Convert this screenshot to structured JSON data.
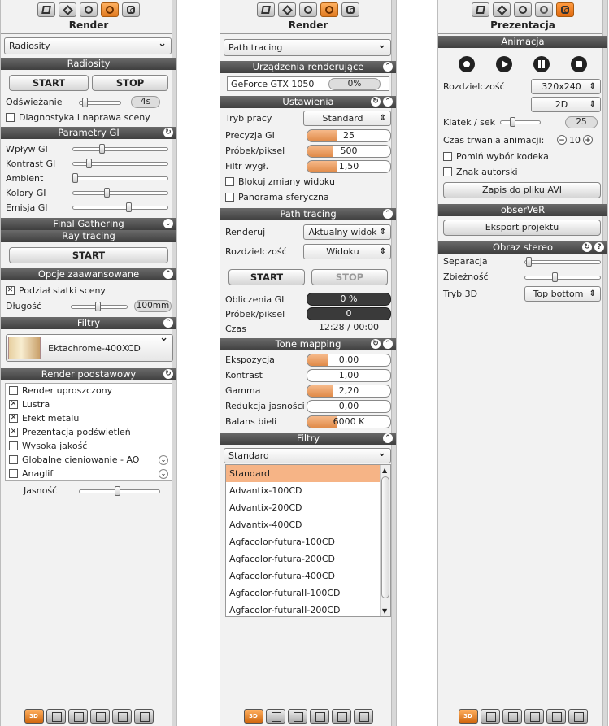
{
  "p1": {
    "title": "Render",
    "mode": "Radiosity",
    "radiosity_header": "Radiosity",
    "start": "START",
    "stop": "STOP",
    "refresh_label": "Odświeżanie",
    "refresh_value": "4s",
    "diag_label": "Diagnostyka i naprawa sceny",
    "gi_header": "Parametry GI",
    "gi_params": [
      {
        "label": "Wpływ GI",
        "level": 0.3
      },
      {
        "label": "Kontrast GI",
        "level": 0.15
      },
      {
        "label": "Ambient",
        "level": 0.0
      },
      {
        "label": "Kolory GI",
        "level": 0.35
      },
      {
        "label": "Emisja GI",
        "level": 0.6
      }
    ],
    "final_gathering": "Final Gathering",
    "ray_tracing": "Ray tracing",
    "rt_start": "START",
    "adv_header": "Opcje zaawansowane",
    "mesh_label": "Podział siatki sceny",
    "length_label": "Długość",
    "length_value": "100mm",
    "filters_header": "Filtry",
    "filter_name": "Ektachrome-400XCD",
    "basic_header": "Render podstawowy",
    "basic_items": [
      {
        "label": "Render uproszczony",
        "checked": false
      },
      {
        "label": "Lustra",
        "checked": true
      },
      {
        "label": "Efekt metalu",
        "checked": true
      },
      {
        "label": "Prezentacja podświetleń",
        "checked": true
      },
      {
        "label": "Wysoka jakość",
        "checked": false
      },
      {
        "label": "Globalne cieniowanie - AO",
        "checked": false
      },
      {
        "label": "Anaglif",
        "checked": false
      }
    ],
    "brightness_label": "Jasność"
  },
  "p2": {
    "title": "Render",
    "mode": "Path tracing",
    "devices_header": "Urządzenia renderujące",
    "device_name": "GeForce GTX 1050",
    "device_value": "0%",
    "settings_header": "Ustawienia",
    "work_mode_label": "Tryb pracy",
    "work_mode_value": "Standard",
    "settings": [
      {
        "label": "Precyzja GI",
        "value": "25",
        "level": 0.35
      },
      {
        "label": "Próbek/piksel",
        "value": "500",
        "level": 0.3
      },
      {
        "label": "Filtr wygł.",
        "value": "1,50",
        "level": 0.35
      }
    ],
    "lock_label": "Blokuj zmiany widoku",
    "panorama_label": "Panorama sferyczna",
    "pt_header": "Path tracing",
    "render_label": "Renderuj",
    "render_value": "Aktualny widok",
    "res_label": "Rozdzielczość",
    "res_value": "Widoku",
    "start": "START",
    "stop": "STOP",
    "stats": [
      {
        "label": "Obliczenia GI",
        "value": "0 %",
        "dark": true
      },
      {
        "label": "Próbek/piksel",
        "value": "0",
        "dark": true
      },
      {
        "label": "Czas",
        "value": "12:28 / 00:00",
        "dark": false
      }
    ],
    "tone_header": "Tone mapping",
    "tone": [
      {
        "label": "Ekspozycja",
        "value": "0,00",
        "level": 0.25
      },
      {
        "label": "Kontrast",
        "value": "1,00",
        "level": 0.0
      },
      {
        "label": "Gamma",
        "value": "2,20",
        "level": 0.3
      },
      {
        "label": "Redukcja jasności",
        "value": "0,00",
        "level": 0.0
      },
      {
        "label": "Balans bieli",
        "value": "6000 K",
        "level": 0.35
      }
    ],
    "filters_header": "Filtry",
    "filter_value": "Standard",
    "filter_list": [
      "Standard",
      "Advantix-100CD",
      "Advantix-200CD",
      "Advantix-400CD",
      "Agfacolor-futura-100CD",
      "Agfacolor-futura-200CD",
      "Agfacolor-futura-400CD",
      "Agfacolor-futuraII-100CD",
      "Agfacolor-futuraII-200CD"
    ]
  },
  "p3": {
    "title": "Prezentacja",
    "anim_header": "Animacja",
    "res_label": "Rozdzielczość",
    "res_value": "320x240",
    "mode_value": "2D",
    "fps_label": "Klatek / sek",
    "fps_value": "25",
    "duration_label": "Czas trwania animacji:",
    "duration_value": "10",
    "skip_codec_label": "Pomiń wybór kodeka",
    "watermark_label": "Znak autorski",
    "save_avi": "Zapis do pliku AVI",
    "observer_header": "obserVeR",
    "export_project": "Eksport projektu",
    "stereo_header": "Obraz stereo",
    "separation_label": "Separacja",
    "convergence_label": "Zbieżność",
    "mode3d_label": "Tryb 3D",
    "mode3d_value": "Top bottom"
  },
  "bottom": {
    "badge": "3D"
  },
  "colors": {
    "accent": "#e8873a",
    "header": "#4a4a4a",
    "panel": "#f2f2f2"
  }
}
